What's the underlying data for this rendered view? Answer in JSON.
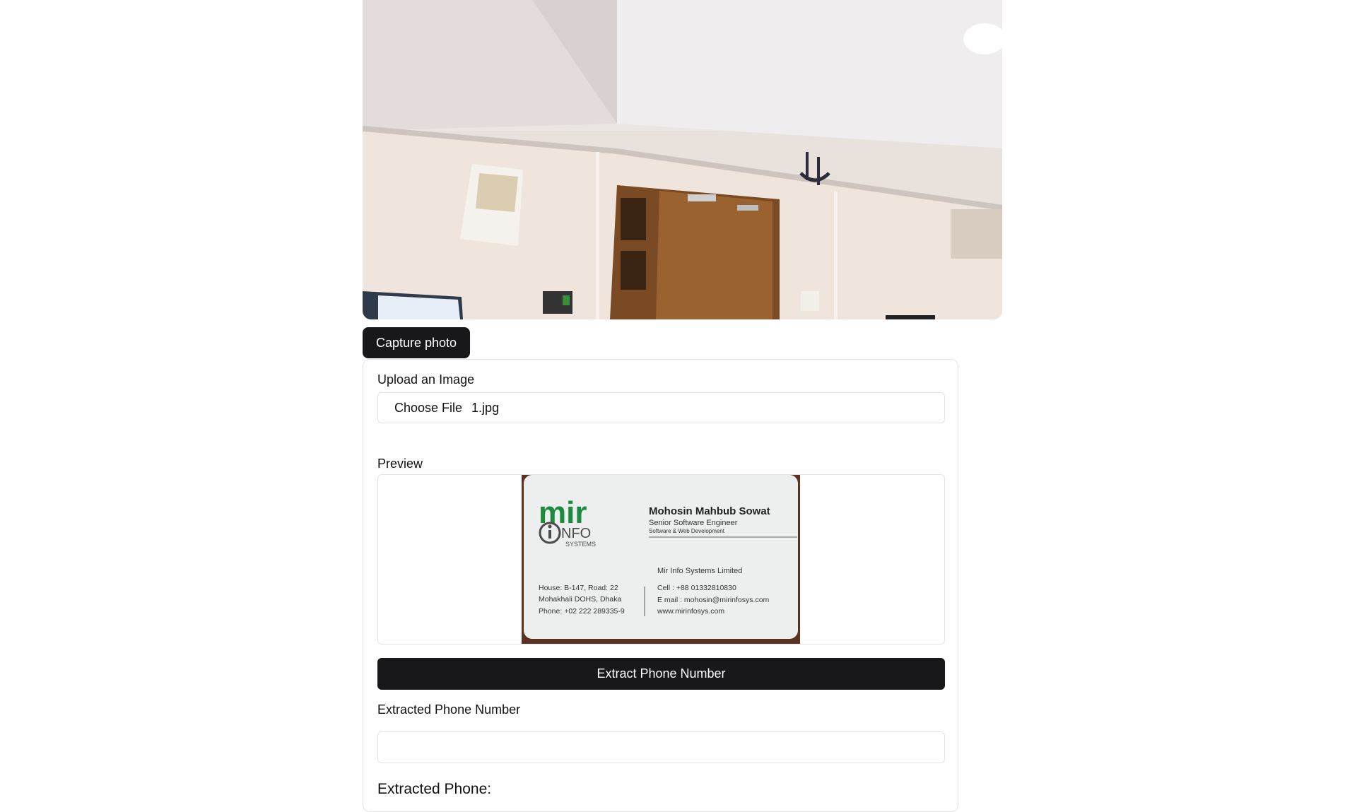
{
  "webcam": {
    "label": "webcam-feed"
  },
  "capture": {
    "label": "Capture photo"
  },
  "upload": {
    "label": "Upload an Image",
    "button_label": "Choose File",
    "file_name": "1.jpg"
  },
  "preview": {
    "label": "Preview",
    "card": {
      "logo_main": "mir",
      "logo_info": "NFO",
      "logo_sub": "SYSTEMS",
      "name": "Mohosin Mahbub Sowat",
      "title": "Senior Software Engineer",
      "dept": "Software & Web Development",
      "company": "Mir Info Systems Limited",
      "cell": "Cell    : +88 01332810830",
      "email": "E mail : mohosin@mirinfosys.com",
      "web": "www.mirinfosys.com",
      "addr1": "House: B-147, Road: 22",
      "addr2": "Mohakhali DOHS, Dhaka",
      "phone": "Phone: +02 222 289335-9"
    }
  },
  "extract": {
    "button_label": "Extract Phone Number"
  },
  "result": {
    "label": "Extracted Phone Number",
    "value": "",
    "heading": "Extracted Phone:"
  },
  "colors": {
    "primary_button": "#18181b",
    "border": "#e4e4e7",
    "logo_green": "#1e8a3e"
  }
}
